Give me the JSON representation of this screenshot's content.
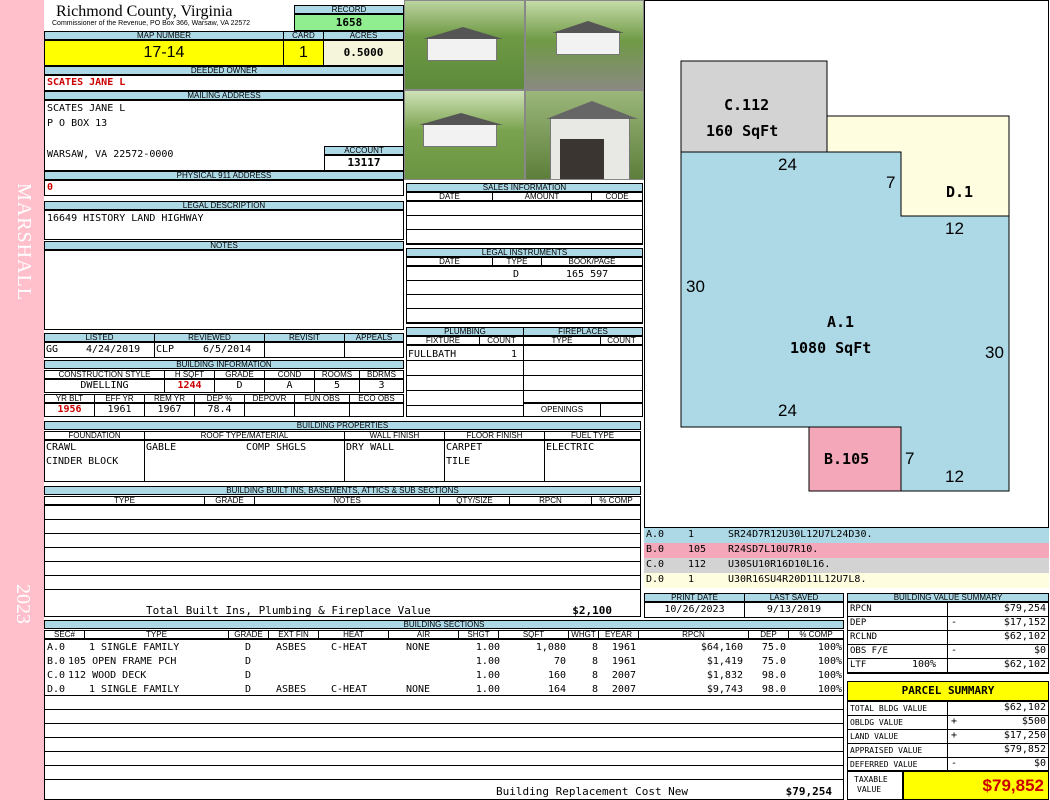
{
  "county": {
    "name": "Richmond County, Virginia",
    "sub": "Commissioner of the Revenue, PO Box 366, Warsaw, VA 22572"
  },
  "record": {
    "label": "RECORD",
    "value": "1658"
  },
  "map": {
    "label": "MAP NUMBER",
    "value": "17-14",
    "card_label": "CARD",
    "card": "1",
    "acres_label": "ACRES",
    "acres": "0.5000"
  },
  "owner": {
    "label": "DEEDED OWNER",
    "value": "SCATES JANE L"
  },
  "mailing": {
    "label": "MAILING ADDRESS",
    "line1": "SCATES JANE L",
    "line2": "P O BOX 13",
    "line3": "WARSAW, VA 22572-0000"
  },
  "account": {
    "label": "ACCOUNT",
    "value": "13117"
  },
  "physical": {
    "label": "PHYSICAL 911 ADDRESS",
    "value": "0"
  },
  "legal": {
    "label": "LEGAL DESCRIPTION",
    "value": "16649 HISTORY LAND HIGHWAY"
  },
  "notes": {
    "label": "NOTES"
  },
  "side_text": {
    "district": "MARSHALL",
    "year": "2023"
  },
  "sales": {
    "label": "SALES INFORMATION",
    "cols": [
      "DATE",
      "AMOUNT",
      "CODE"
    ]
  },
  "instruments": {
    "label": "LEGAL INSTRUMENTS",
    "cols": [
      "DATE",
      "TYPE",
      "BOOK/PAGE"
    ],
    "row_type": "D",
    "row_book": "165 597"
  },
  "listed": {
    "listed_label": "LISTED",
    "reviewed_label": "REVIEWED",
    "revisit_label": "REVISIT",
    "appeals_label": "APPEALS",
    "lister": "GG",
    "listed_date": "4/24/2019",
    "reviewer": "CLP",
    "reviewed_date": "6/5/2014"
  },
  "plumbing": {
    "label": "PLUMBING",
    "fixture_label": "FIXTURE",
    "count_label": "COUNT",
    "fixture": "FULLBATH",
    "count": "1"
  },
  "fireplaces": {
    "label": "FIREPLACES",
    "type_label": "TYPE",
    "count_label": "COUNT",
    "openings_label": "OPENINGS"
  },
  "building_info": {
    "label": "BUILDING INFORMATION",
    "h1": [
      "CONSTRUCTION STYLE",
      "H SQFT",
      "GRADE",
      "COND",
      "ROOMS",
      "BDRMS"
    ],
    "v1": [
      "DWELLING",
      "1244",
      "D",
      "A",
      "5",
      "3"
    ],
    "h2": [
      "YR BLT",
      "EFF YR",
      "REM YR",
      "DEP %",
      "DEPOVR",
      "FUN OBS",
      "ECO OBS"
    ],
    "v2": [
      "1956",
      "1961",
      "1967",
      "78.4",
      "",
      "",
      ""
    ]
  },
  "properties": {
    "label": "BUILDING PROPERTIES",
    "cols": [
      "FOUNDATION",
      "ROOF TYPE/MATERIAL",
      "WALL FINISH",
      "FLOOR FINISH",
      "FUEL TYPE"
    ],
    "foundation1": "CRAWL",
    "foundation2": "CINDER BLOCK",
    "roof_type": "GABLE",
    "roof_mat": "COMP SHGLS",
    "wall": "DRY WALL",
    "floor1": "CARPET",
    "floor2": "TILE",
    "fuel": "ELECTRIC"
  },
  "builtins": {
    "label": "BUILDING BUILT INS, BASEMENTS, ATTICS & SUB SECTIONS",
    "cols": [
      "TYPE",
      "GRADE",
      "NOTES",
      "QTY/SIZE",
      "RPCN",
      "% COMP"
    ],
    "total_label": "Total Built Ins, Plumbing & Fireplace Value",
    "total": "$2,100"
  },
  "print": {
    "print_label": "PRINT DATE",
    "saved_label": "LAST SAVED",
    "print_date": "10/26/2023",
    "saved_date": "9/13/2019"
  },
  "sections": {
    "label": "BUILDING SECTIONS",
    "cols": [
      "SEC#",
      "TYPE",
      "GRADE",
      "EXT FIN",
      "HEAT",
      "AIR",
      "SHGT",
      "SQFT",
      "WHGT",
      "EYEAR",
      "RPCN",
      "DEP",
      "% COMP"
    ],
    "rows": [
      [
        "A.0",
        "1 SINGLE FAMILY",
        "D",
        "ASBES",
        "C-HEAT",
        "NONE",
        "1.00",
        "1,080",
        "8",
        "1961",
        "$64,160",
        "75.0",
        "100%"
      ],
      [
        "B.0",
        "105 OPEN FRAME PCH",
        "D",
        "",
        "",
        "",
        "1.00",
        "70",
        "8",
        "1961",
        "$1,419",
        "75.0",
        "100%"
      ],
      [
        "C.0",
        "112 WOOD DECK",
        "D",
        "",
        "",
        "",
        "1.00",
        "160",
        "8",
        "2007",
        "$1,832",
        "98.0",
        "100%"
      ],
      [
        "D.0",
        "1 SINGLE FAMILY",
        "D",
        "ASBES",
        "C-HEAT",
        "NONE",
        "1.00",
        "164",
        "8",
        "2007",
        "$9,743",
        "98.0",
        "100%"
      ]
    ],
    "replacement_label": "Building Replacement Cost New",
    "replacement": "$79,254"
  },
  "sketch": {
    "areas": [
      {
        "code": "C.112",
        "area": "160 SqFt"
      },
      {
        "code": "D.1",
        "area": ""
      },
      {
        "code": "A.1",
        "area": "1080 SqFt"
      },
      {
        "code": "B.105",
        "area": ""
      }
    ],
    "dims": [
      "24",
      "7",
      "12",
      "30",
      "30",
      "24",
      "7",
      "12"
    ]
  },
  "vectors": [
    {
      "sec": "A.0",
      "n": "1",
      "code": "SR24D7R12U30L12U7L24D30.",
      "color": "#add8e6"
    },
    {
      "sec": "B.0",
      "n": "105",
      "code": "R24SD7L10U7R10.",
      "color": "#f4a7b9"
    },
    {
      "sec": "C.0",
      "n": "112",
      "code": "U30SU10R16D10L16.",
      "color": "#d3d3d3"
    },
    {
      "sec": "D.0",
      "n": "1",
      "code": "U30R16SU4R20D11L12U7L8.",
      "color": "#fffde0"
    }
  ],
  "bvs": {
    "label": "BUILDING VALUE SUMMARY",
    "rpcn_label": "RPCN",
    "rpcn": "$79,254",
    "dep_label": "DEP",
    "dep_sign": "-",
    "dep": "$17,152",
    "rclnd_label": "RCLND",
    "rclnd": "$62,102",
    "obs_label": "OBS F/E",
    "obs_sign": "-",
    "obs": "$0",
    "ltf_label": "LTF",
    "ltf_pct": "100%",
    "ltf": "$62,102"
  },
  "parcel": {
    "label": "PARCEL SUMMARY",
    "bldg_label": "TOTAL BLDG VALUE",
    "bldg": "$62,102",
    "obldg_label": "OBLDG VALUE",
    "obldg_sign": "+",
    "obldg": "$500",
    "land_label": "LAND VALUE",
    "land_sign": "+",
    "land": "$17,250",
    "appraised_label": "APPRAISED VALUE",
    "appraised": "$79,852",
    "deferred_label": "DEFERRED VALUE",
    "deferred_sign": "-",
    "deferred": "$0",
    "taxable_label1": "TAXABLE",
    "taxable_label2": "VALUE",
    "taxable": "$79,852"
  },
  "colors": {
    "header": "#add8e6",
    "yellow": "#ffff00",
    "pink_strip": "#ffc0cb",
    "green": "#90ee90"
  }
}
